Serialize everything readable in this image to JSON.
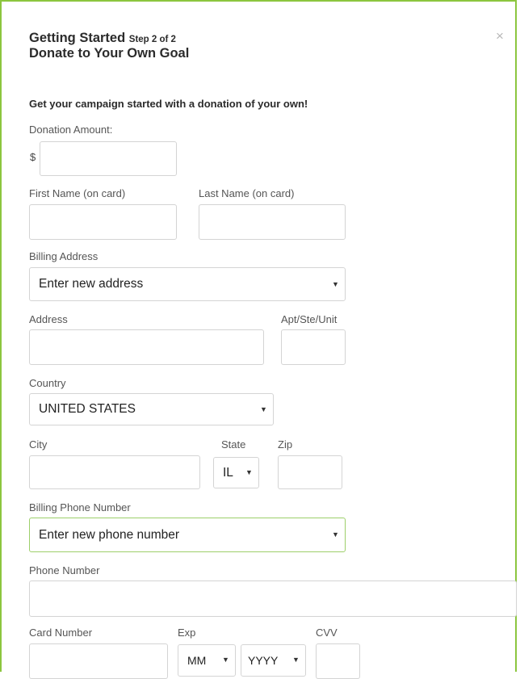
{
  "header": {
    "title": "Getting Started",
    "step": "Step 2 of 2",
    "subtitle": "Donate to Your Own Goal",
    "close_symbol": "×"
  },
  "intro": "Get your campaign started with a donation of your own!",
  "donation": {
    "label": "Donation Amount:",
    "currency": "$",
    "value": ""
  },
  "name": {
    "first_label": "First Name (on card)",
    "last_label": "Last Name (on card)"
  },
  "billing_address": {
    "label": "Billing Address",
    "selected": "Enter new address"
  },
  "address": {
    "label": "Address",
    "apt_label": "Apt/Ste/Unit"
  },
  "country": {
    "label": "Country",
    "selected": "UNITED STATES"
  },
  "city": {
    "city_label": "City",
    "state_label": "State",
    "state_selected": "IL",
    "zip_label": "Zip"
  },
  "billing_phone": {
    "label": "Billing Phone Number",
    "selected": "Enter new phone number"
  },
  "phone": {
    "label": "Phone Number"
  },
  "card": {
    "number_label": "Card Number",
    "exp_label": "Exp",
    "month_selected": "MM",
    "year_selected": "YYYY",
    "cvv_label": "CVV"
  },
  "icons": {
    "close": "close-icon",
    "dropdown": "caret-down-icon"
  },
  "colors": {
    "border_accent": "#8cc63f",
    "input_border": "#d4d4d4"
  }
}
